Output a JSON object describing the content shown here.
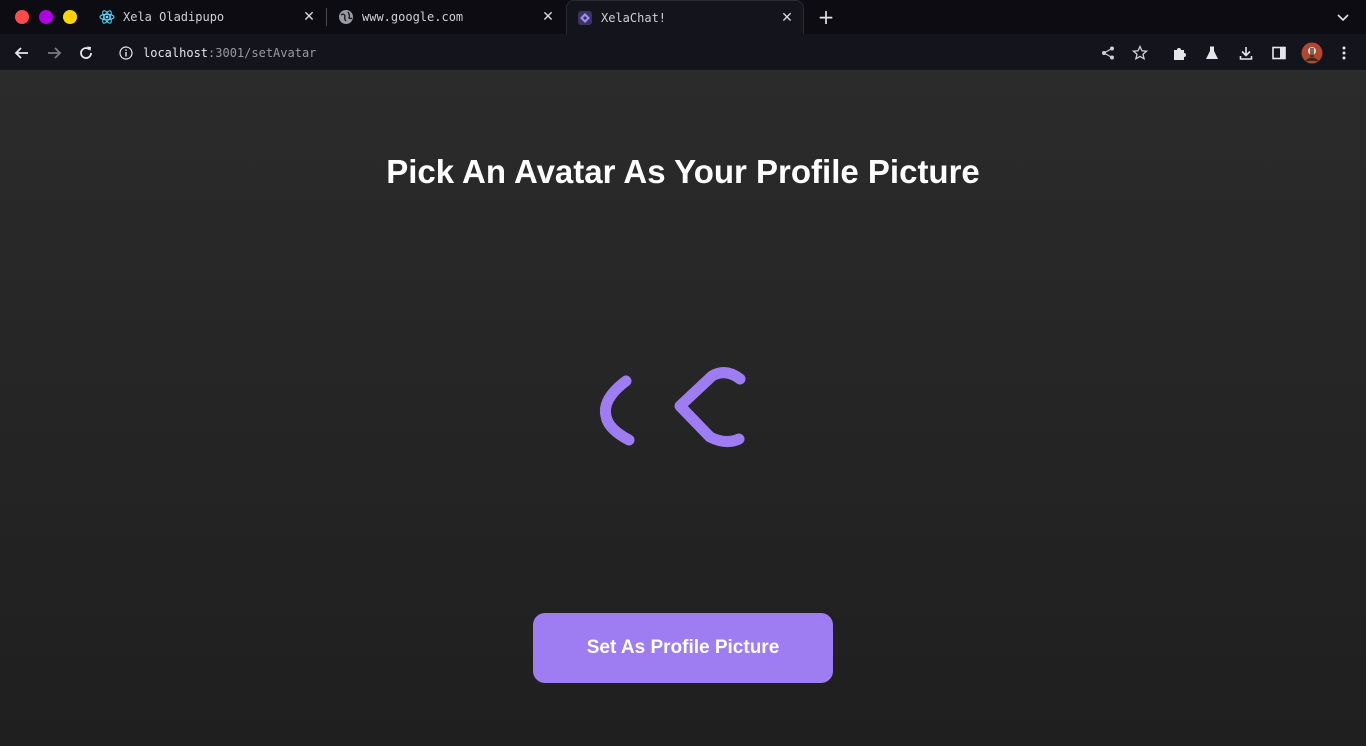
{
  "browser": {
    "tabs": [
      {
        "title": "Xela Oladipupo",
        "favicon": "react-icon"
      },
      {
        "title": "www.google.com",
        "favicon": "globe-icon"
      },
      {
        "title": "XelaChat!",
        "favicon": "xelachat-icon",
        "active": true
      }
    ],
    "url": {
      "host": "localhost",
      "rest": ":3001/setAvatar"
    }
  },
  "page": {
    "title": "Pick An Avatar As Your Profile Picture",
    "button_label": "Set As Profile Picture",
    "loader_icon": "loading-spinner-icon",
    "accent_color": "#9e7df2",
    "background_color": "#232323"
  }
}
